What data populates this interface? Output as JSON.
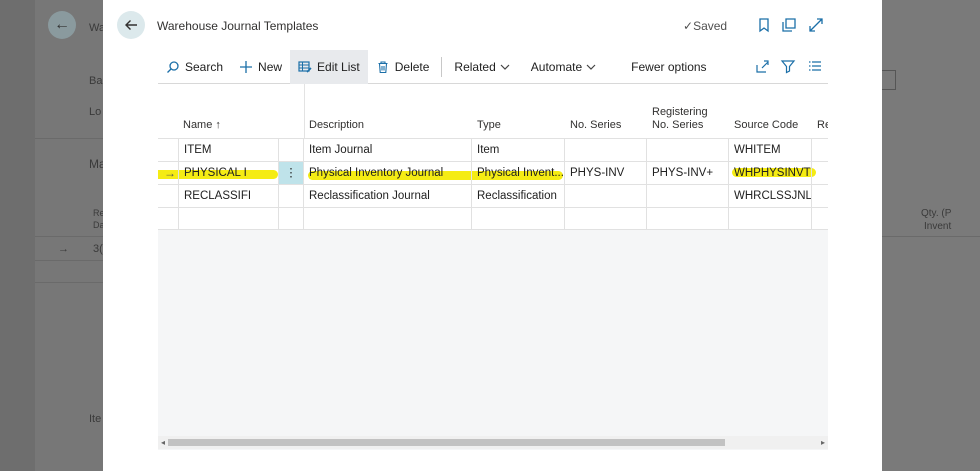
{
  "background": {
    "labels": [
      "Wa",
      "Ba",
      "Lo",
      "Ma",
      "Re",
      "Da",
      "3(",
      "Ite",
      "Qty. (P",
      "Invent"
    ]
  },
  "header": {
    "title": "Warehouse Journal Templates",
    "saved_label": "Saved"
  },
  "actions": {
    "search": "Search",
    "new": "New",
    "edit_list": "Edit List",
    "delete": "Delete",
    "related": "Related",
    "automate": "Automate",
    "fewer_options": "Fewer options"
  },
  "table": {
    "columns": {
      "name": "Name ↑",
      "description": "Description",
      "type": "Type",
      "no_series": "No. Series",
      "registering_line1": "Registering",
      "registering_line2": "No. Series",
      "source_code": "Source Code",
      "reason": "Rea"
    },
    "rows": [
      {
        "name": "ITEM",
        "description": "Item Journal",
        "type": "Item",
        "no_series": "",
        "registering": "",
        "source_code": "WHITEM"
      },
      {
        "name": "PHYSICAL I",
        "description": "Physical Inventory Journal",
        "type": "Physical Invent...",
        "no_series": "PHYS-INV",
        "registering": "PHYS-INV+",
        "source_code": "WHPHYSINVT"
      },
      {
        "name": "RECLASSIFI",
        "description": "Reclassification Journal",
        "type": "Reclassification",
        "no_series": "",
        "registering": "",
        "source_code": "WHRCLSSJNL"
      },
      {
        "name": "",
        "description": "",
        "type": "",
        "no_series": "",
        "registering": "",
        "source_code": ""
      }
    ],
    "selected_arrow": "→",
    "row_menu": "⋮"
  },
  "colors": {
    "accent": "#1b6fa8",
    "highlight": "#f4ea00",
    "selected_cell": "#bfe3ea"
  }
}
